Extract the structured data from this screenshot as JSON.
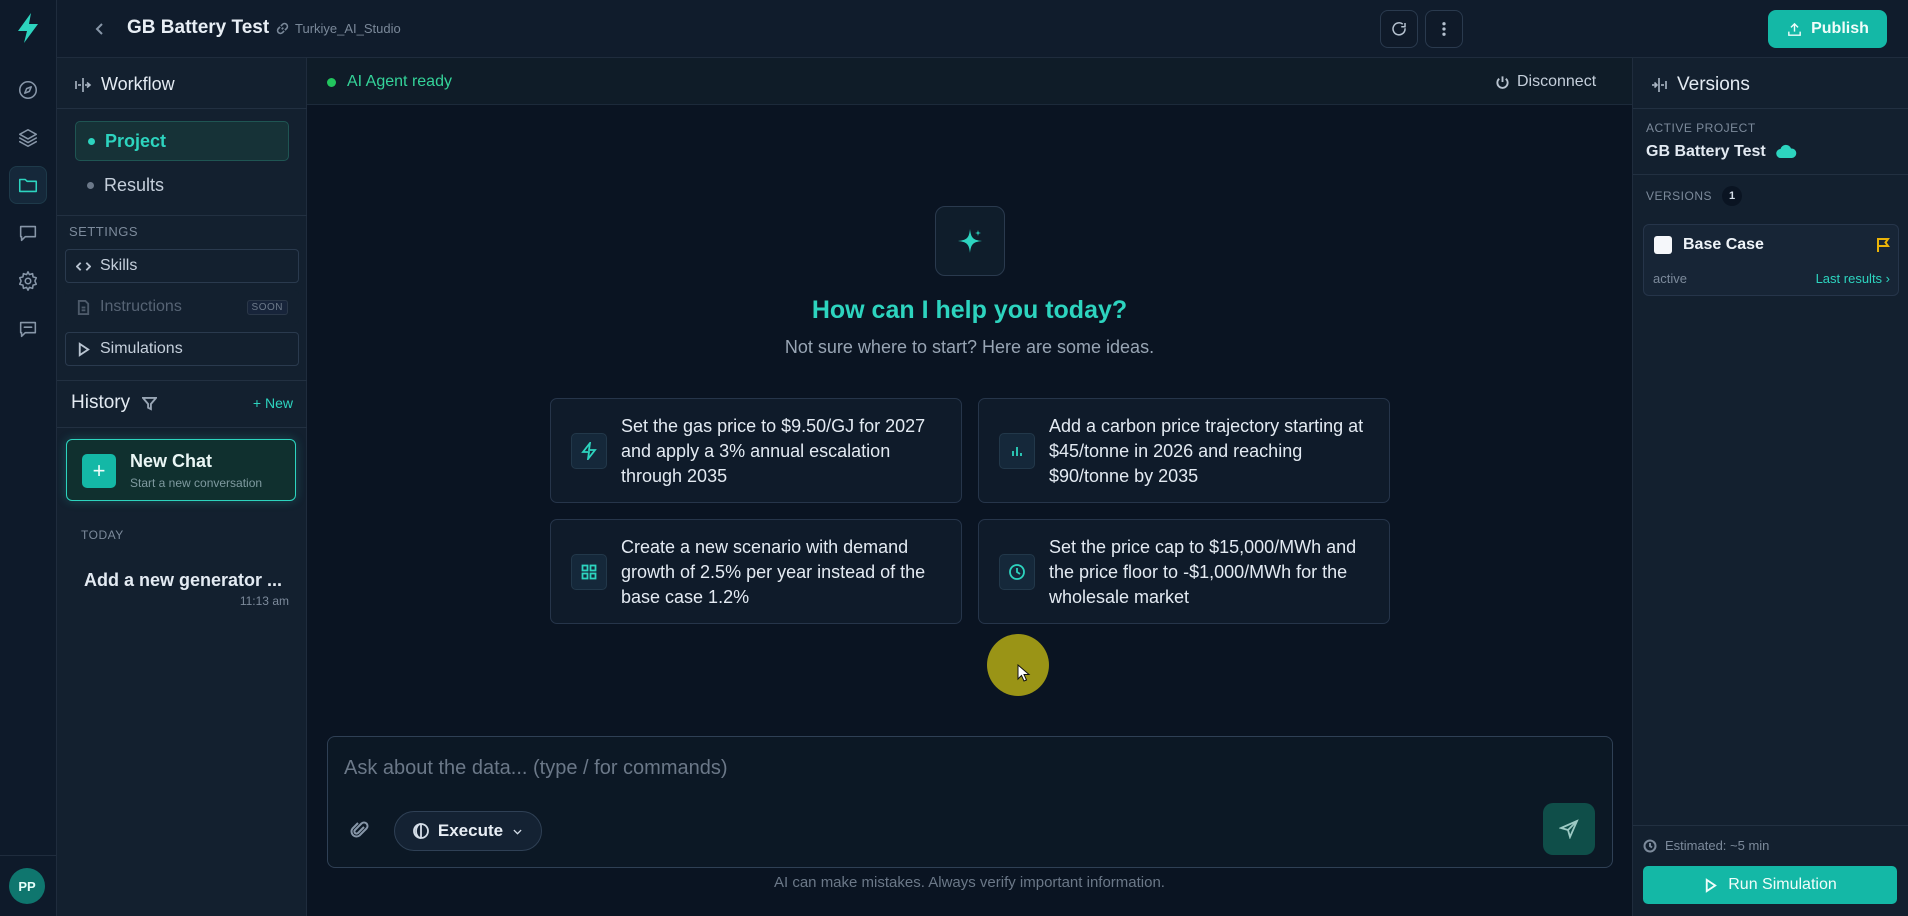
{
  "topbar": {
    "title": "GB Battery Test",
    "org": "Turkiye_AI_Studio",
    "publish_label": "Publish"
  },
  "workflow": {
    "title": "Workflow",
    "nav": {
      "project": "Project",
      "results": "Results"
    },
    "settings_label": "SETTINGS",
    "settings_items": {
      "skills": "Skills",
      "instructions": "Instructions",
      "instructions_badge": "SOON",
      "simulations": "Simulations"
    },
    "history": {
      "title": "History",
      "new_label": "+ New",
      "new_chat_title": "New Chat",
      "new_chat_subtitle": "Start a new conversation",
      "group_label": "TODAY",
      "items": [
        {
          "title": "Add a new generator ...",
          "time": "11:13 am"
        }
      ]
    }
  },
  "main": {
    "status_text": "AI Agent ready",
    "disconnect_label": "Disconnect",
    "heading": "How can I help you today?",
    "subheading": "Not sure where to start? Here are some ideas.",
    "suggestions": [
      {
        "icon": "lightning-icon",
        "text": "Set the gas price to $9.50/GJ for 2027 and apply a 3% annual escalation through 2035"
      },
      {
        "icon": "bar-chart-icon",
        "text": "Add a carbon price trajectory starting at $45/tonne in 2026 and reaching $90/tonne by 2035"
      },
      {
        "icon": "grid-icon",
        "text": "Create a new scenario with demand growth of 2.5% per year instead of the base case 1.2%"
      },
      {
        "icon": "clock-icon",
        "text": "Set the price cap to $15,000/MWh and the price floor to -$1,000/MWh for the wholesale market"
      }
    ],
    "input_placeholder": "Ask about the data... (type / for commands)",
    "mode_label": "Execute",
    "disclaimer": "AI can make mistakes. Always verify important information."
  },
  "versions": {
    "title": "Versions",
    "active_project_label": "ACTIVE PROJECT",
    "active_project_name": "GB Battery Test",
    "versions_label": "VERSIONS",
    "versions_count": "1",
    "items": [
      {
        "name": "Base Case",
        "status": "active",
        "link": "Last results ›"
      }
    ],
    "estimated": "Estimated: ~5 min",
    "run_label": "Run Simulation"
  },
  "user": {
    "initials": "PP"
  },
  "colors": {
    "accent": "#2dd4bf",
    "primary_button": "#14b8a6",
    "status_ready": "#22c55e",
    "flag": "#eab308",
    "background": "#0a1422"
  }
}
